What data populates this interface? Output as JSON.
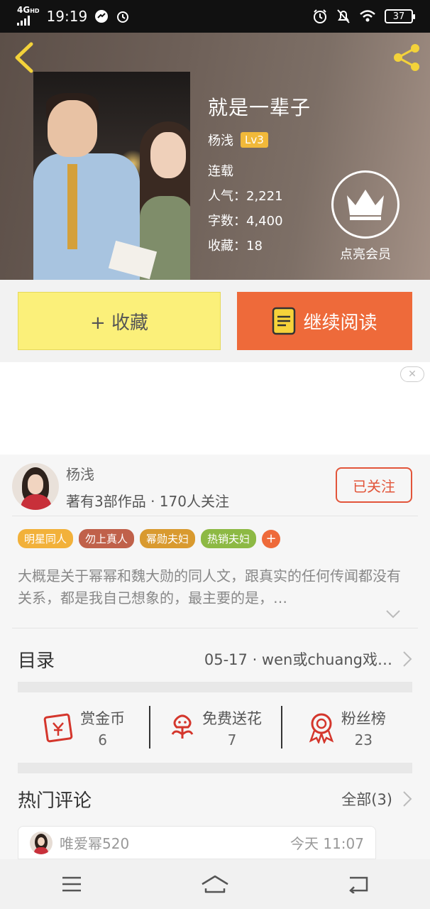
{
  "status_bar": {
    "network": "4G",
    "network_sub": "HD",
    "time": "19:19",
    "battery": "37"
  },
  "book": {
    "title": "就是一辈子",
    "author": "杨浅",
    "level": "Lv3",
    "status": "连载",
    "popularity": "人气：2,221",
    "word_count": "字数：4,400",
    "favorites": "收藏：18",
    "vip_label": "点亮会员"
  },
  "actions": {
    "collect_label": "+ 收藏",
    "read_label": "继续阅读"
  },
  "author_card": {
    "name": "杨浅",
    "stats": "著有3部作品 · 170人关注",
    "follow_label": "已关注"
  },
  "tags": [
    {
      "label": "明星同人",
      "color": "#f2b13a"
    },
    {
      "label": "勿上真人",
      "color": "#c0614a"
    },
    {
      "label": "幂勋夫妇",
      "color": "#d99a2f"
    },
    {
      "label": "热销夫妇",
      "color": "#8db944"
    }
  ],
  "tag_add": "+",
  "description": "大概是关于幂幂和魏大勋的同人文，跟真实的任何传闻都没有关系，都是我自己想象的，最主要的是，…",
  "toc": {
    "label": "目录",
    "latest": "05-17 · wen或chuang戏…"
  },
  "stats": [
    {
      "label": "赏金币",
      "value": "6",
      "icon": "reward-coin-icon"
    },
    {
      "label": "免费送花",
      "value": "7",
      "icon": "flower-icon"
    },
    {
      "label": "粉丝榜",
      "value": "23",
      "icon": "medal-icon"
    }
  ],
  "comments": {
    "title": "热门评论",
    "all_label": "全部(3)",
    "first": {
      "user": "唯爱幂520",
      "time": "今天 11:07"
    }
  },
  "colors": {
    "accent_orange": "#ee6a3a",
    "collect_yellow": "#fbf07a",
    "follow_red": "#e2553a",
    "level_badge": "#f1b93a"
  }
}
